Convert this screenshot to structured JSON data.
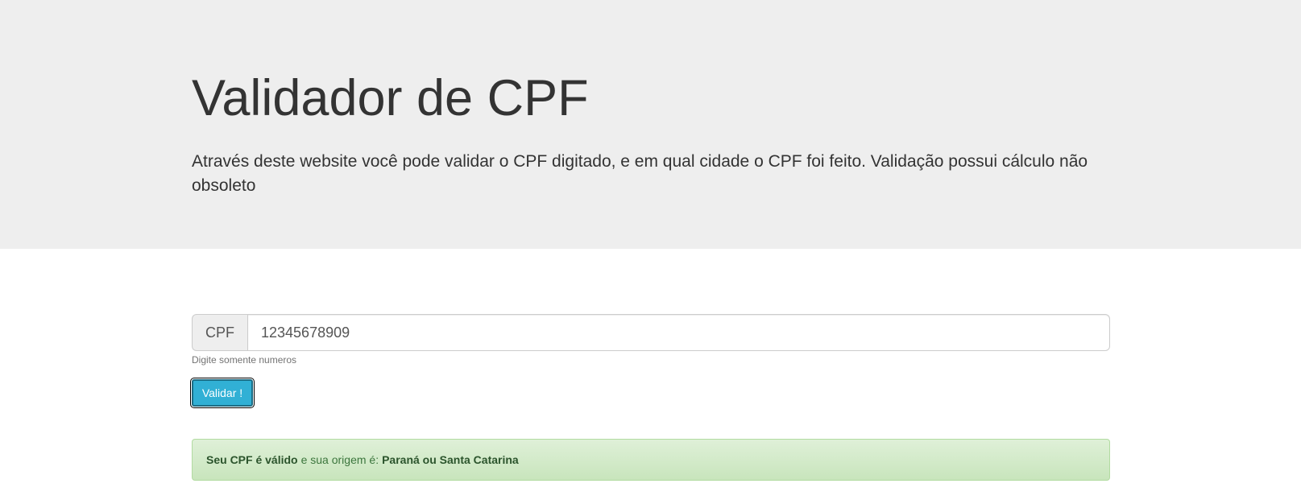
{
  "header": {
    "title": "Validador de CPF",
    "lead": "Através deste website você pode validar o CPF digitado, e em qual cidade o CPF foi feito. Validação possui cálculo não obsoleto"
  },
  "form": {
    "addon_label": "CPF",
    "cpf_value": "12345678909",
    "help_text": "Digite somente numeros",
    "submit_label": "Validar !"
  },
  "result": {
    "status_text": "Seu CPF é válido",
    "middle_text": "e sua origem é:",
    "origin": "Paraná ou Santa Catarina"
  },
  "colors": {
    "jumbotron_bg": "#eeeeee",
    "button_bg": "#31b0d5",
    "alert_bg": "#dff0d8",
    "alert_text": "#3c763d"
  }
}
